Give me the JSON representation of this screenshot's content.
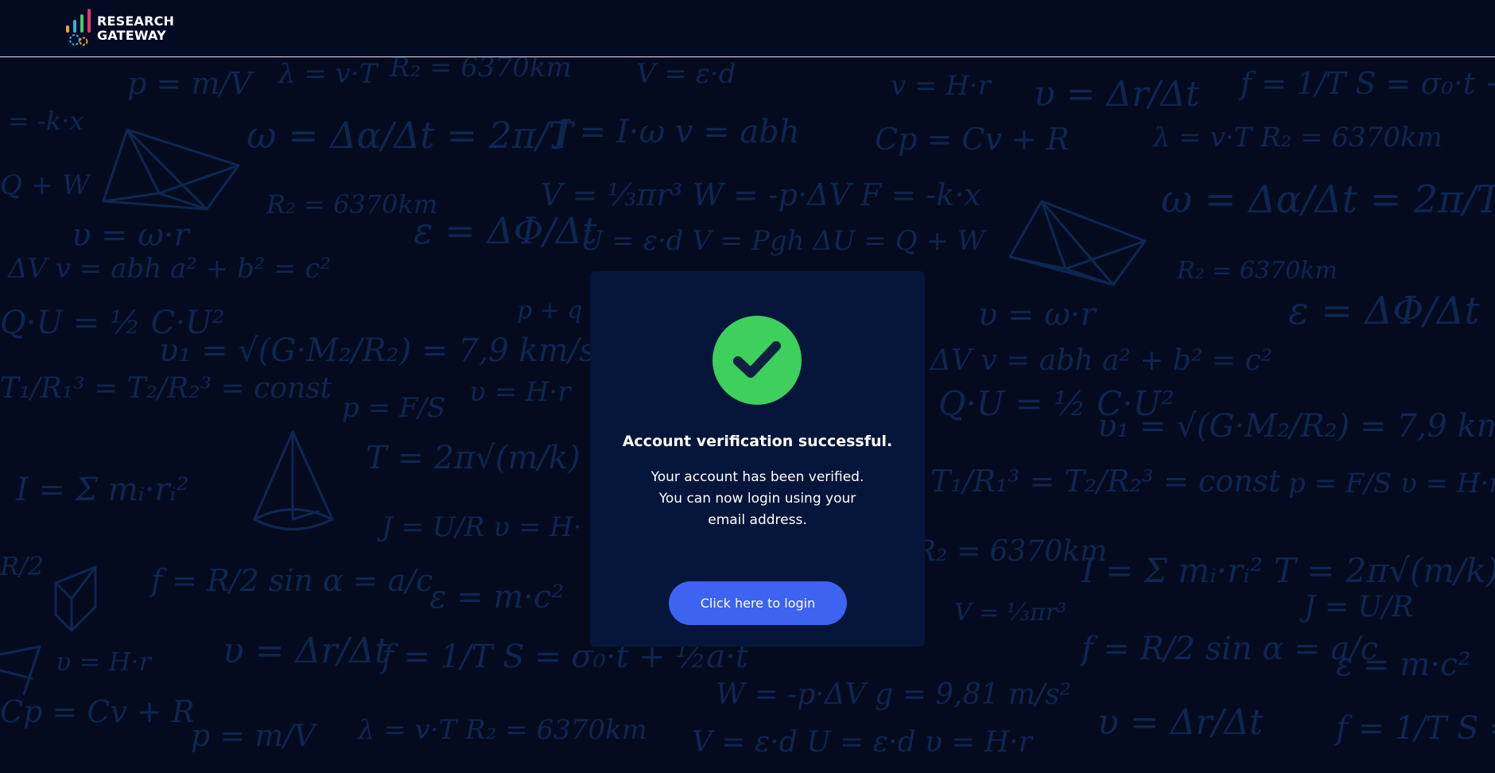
{
  "header": {
    "logo_line1": "RESEARCH",
    "logo_line2": "GATEWAY",
    "logo_icon": "bar-chart-gear-icon"
  },
  "card": {
    "icon": "check-circle-icon",
    "title": "Account verification successful.",
    "body_lines": [
      "Your account has been verified.",
      "You can now login using your",
      "email address."
    ],
    "button_label": "Click here to login"
  },
  "colors": {
    "background": "#040b1f",
    "card": "#06153a",
    "success": "#3ecf5c",
    "button": "#3d63f0",
    "logo_bars": [
      "#f5a623",
      "#2bb5e8",
      "#45c96b",
      "#e8336f"
    ]
  }
}
